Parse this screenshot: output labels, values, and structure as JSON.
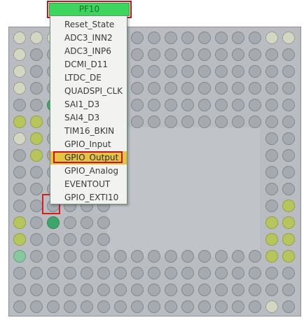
{
  "pin_title": "PF10",
  "menu": {
    "items": [
      "Reset_State",
      "ADC3_INN2",
      "ADC3_INP6",
      "DCMI_D11",
      "LTDC_DE",
      "QUADSPI_CLK",
      "SAI1_D3",
      "SAI4_D3",
      "TIM16_BKIN",
      "GPIO_Input",
      "GPIO_Output",
      "GPIO_Analog",
      "EVENTOUT",
      "GPIO_EXTI10"
    ],
    "selected_index": 10
  },
  "colors": {
    "title_bg": "#3dd55e",
    "selection_bg": "#e6c441",
    "highlight_red": "#c01818",
    "pin_default": "#a5aab1",
    "pin_configured": "#b7c55c",
    "pin_green": "#3ea66a"
  }
}
